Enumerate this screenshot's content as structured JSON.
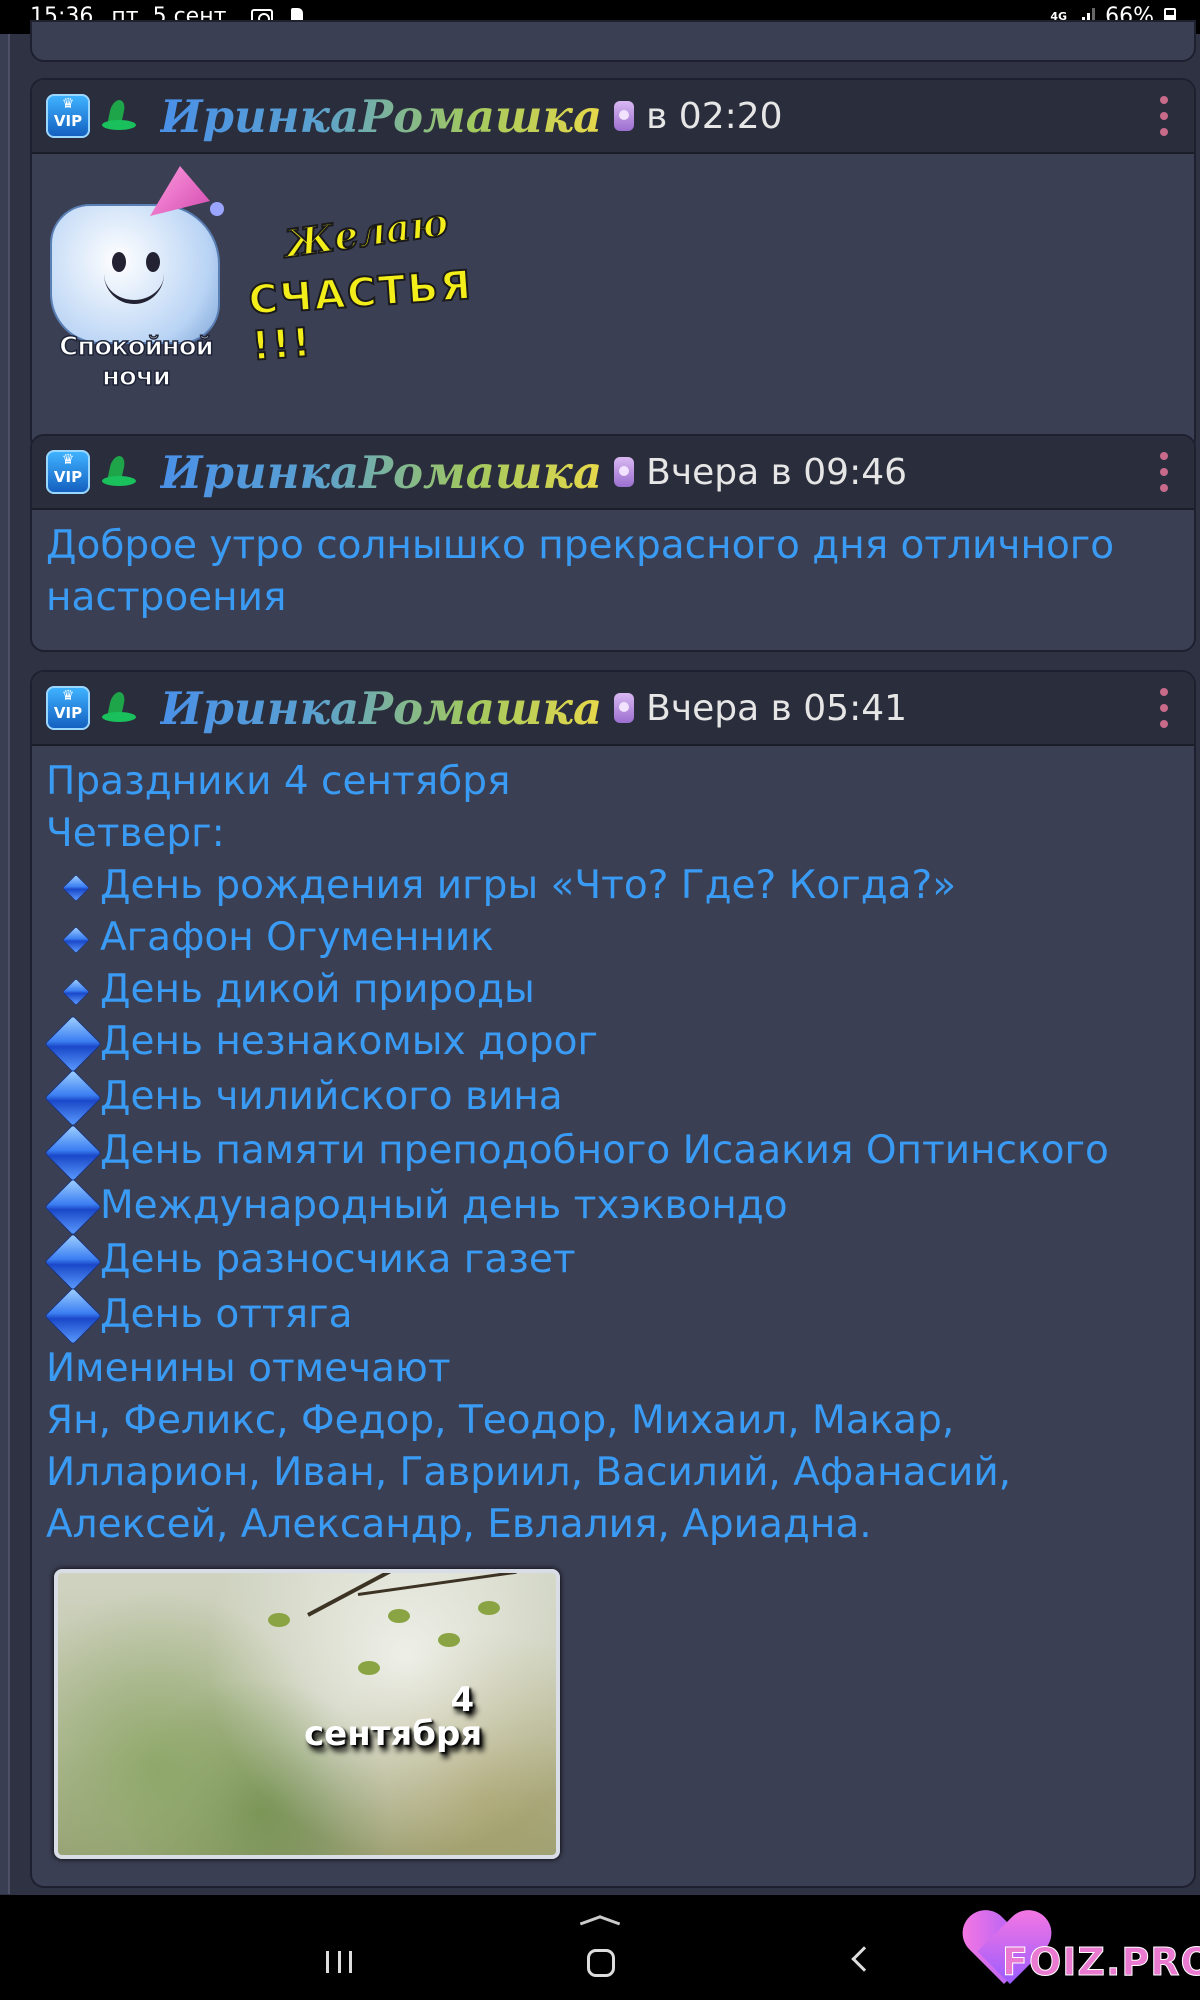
{
  "status_bar": {
    "time": "15:36",
    "date": "пт, 5 сент.",
    "network": "4G",
    "battery": "66%"
  },
  "posts": [
    {
      "username": "ИринкаРомашка",
      "time": "в 02:20",
      "stickers": [
        {
          "name": "pillow-sticker",
          "caption_line1": "Спокойной",
          "caption_line2": "ночи"
        },
        {
          "name": "wish-sticker",
          "line1": "Желаю",
          "line2": "СЧАСТЬЯ !!!"
        }
      ]
    },
    {
      "username": "ИринкаРомашка",
      "time": "Вчера в 09:46",
      "text": "Доброе утро солнышко прекрасного дня отличного настроения"
    },
    {
      "username": "ИринкаРомашка",
      "time": "Вчера в 05:41",
      "title": "Праздники 4 сентября",
      "weekday": "Четверг:",
      "holidays": [
        "День рождения игры «Что? Где? Когда?»",
        "Агафон Огуменник",
        "День дикой природы",
        "День незнакомых дорог",
        "День чилийского вина",
        "День памяти преподобного Исаакия Оптинского",
        "Международный день тхэквондо",
        "День разносчика газет",
        "День оттяга"
      ],
      "names_title": "Именины отмечают",
      "names_line1": "Ян, Феликс, Федор, Теодор, Михаил, Макар,",
      "names_line2": "Илларион, Иван, Гавриил, Василий, Афанасий,",
      "names_line3": "Алексей, Александр, Евлалия, Ариадна.",
      "image": {
        "number": "4",
        "month": "сентября"
      }
    }
  ],
  "watermark": "FOIZ.PRO",
  "colors": {
    "background": "#2f3242",
    "card": "#3b3f53",
    "card_header": "#2a2d3b",
    "post_text": "#3a9bf5"
  }
}
